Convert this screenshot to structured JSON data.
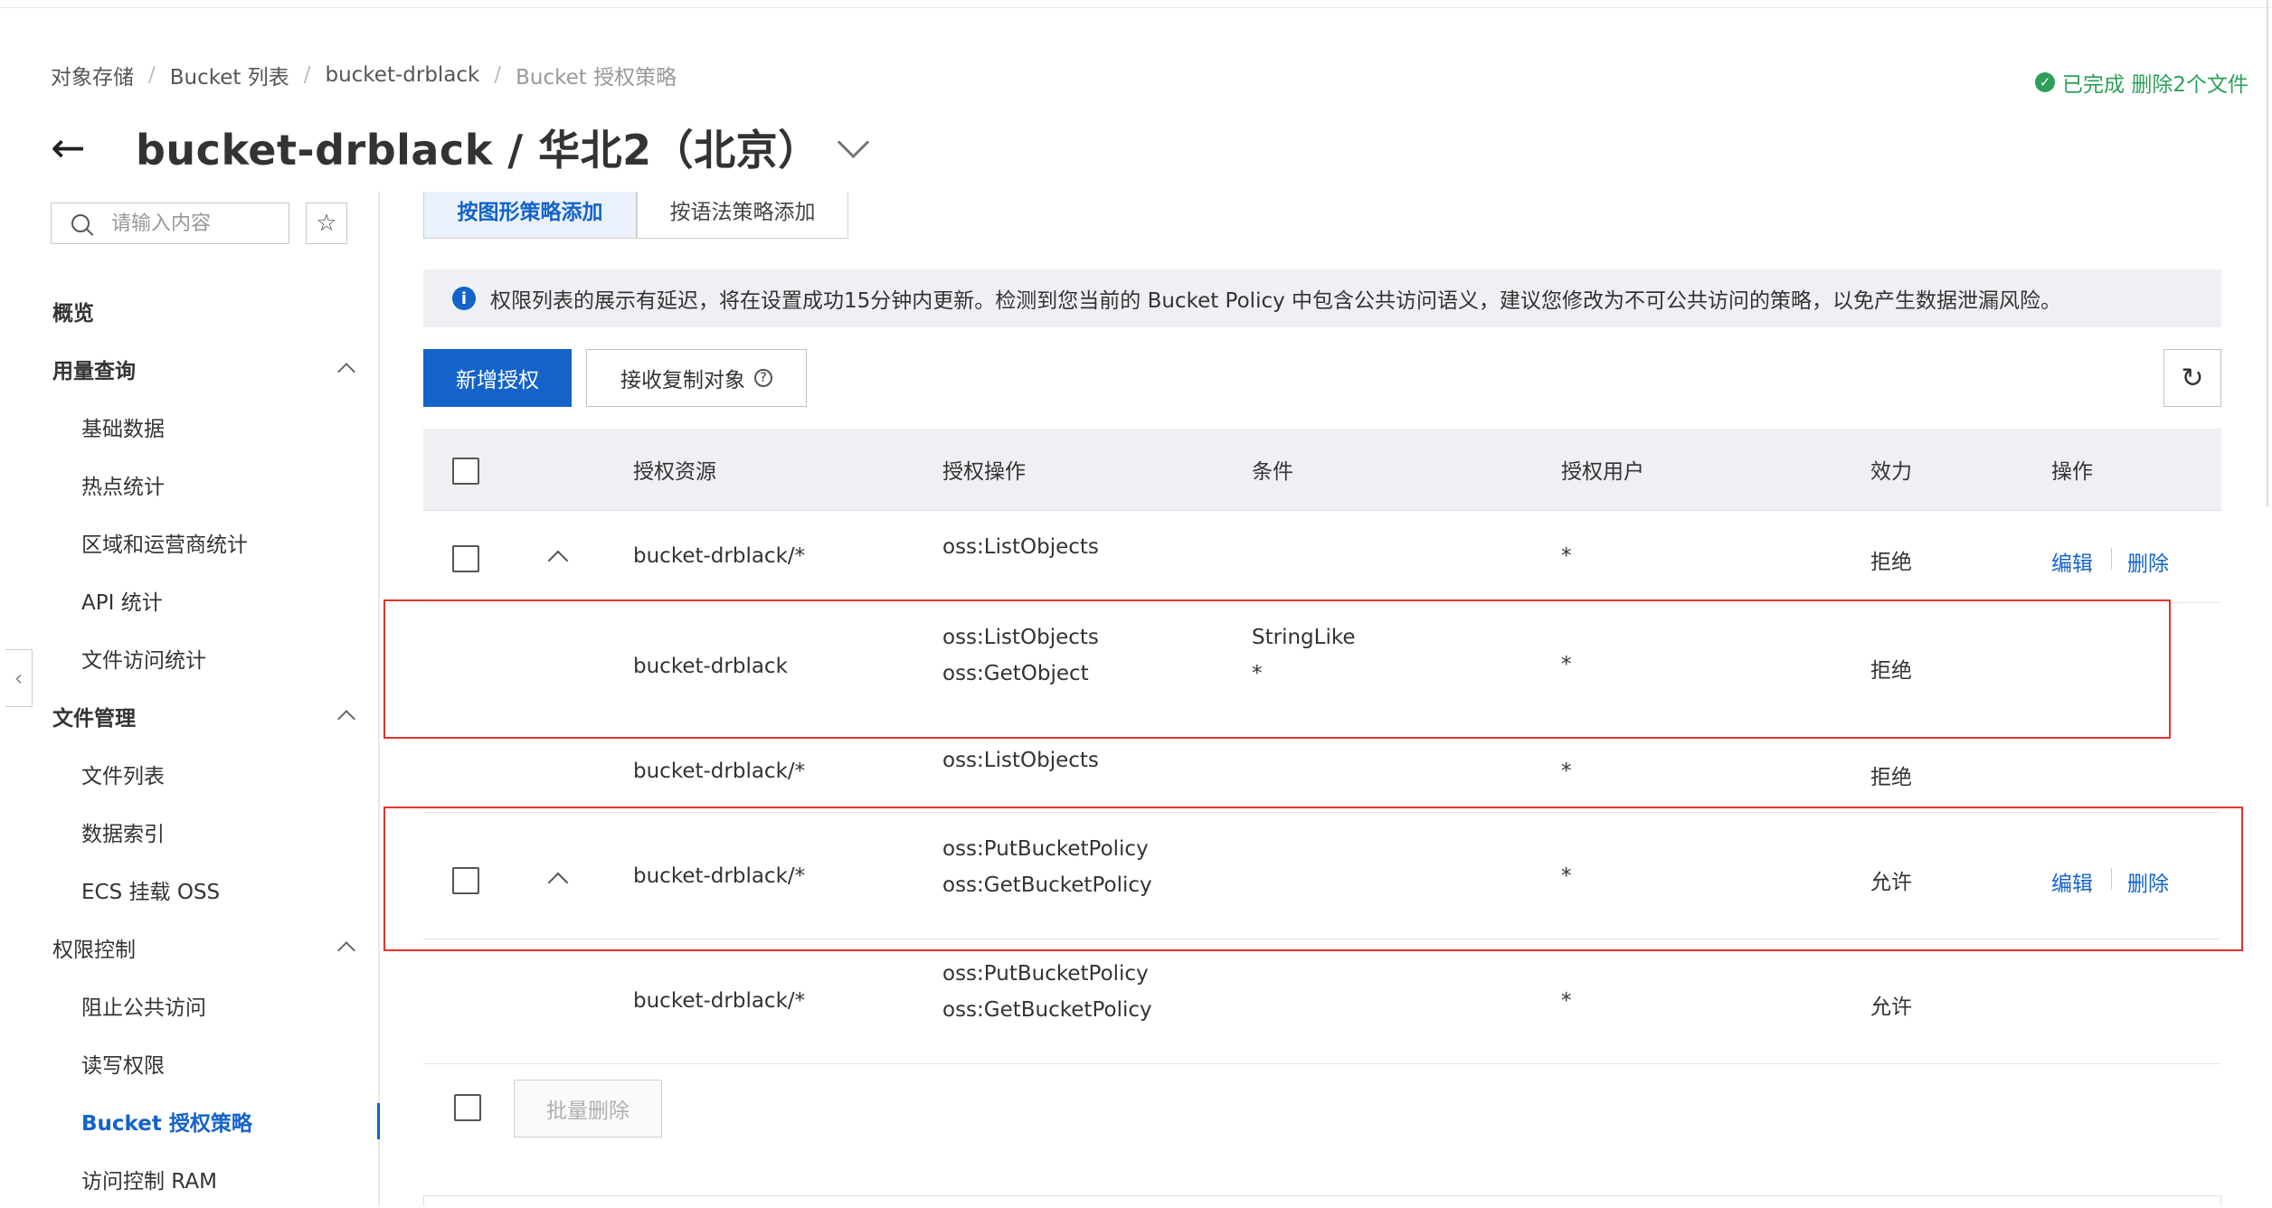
{
  "breadcrumb": [
    "对象存储",
    "Bucket 列表",
    "bucket-drblack",
    "Bucket 授权策略"
  ],
  "status": {
    "text": "已完成 删除2个文件",
    "color": "#2ca05a"
  },
  "header": {
    "back_icon": "arrow-left-icon",
    "title": "bucket-drblack / 华北2（北京）"
  },
  "sidebar": {
    "search_placeholder": "请输入内容",
    "items": [
      {
        "label": "概览",
        "type": "group",
        "expandable": false
      },
      {
        "label": "用量查询",
        "type": "group",
        "expandable": true
      },
      {
        "label": "基础数据",
        "type": "sub"
      },
      {
        "label": "热点统计",
        "type": "sub"
      },
      {
        "label": "区域和运营商统计",
        "type": "sub"
      },
      {
        "label": "API 统计",
        "type": "sub"
      },
      {
        "label": "文件访问统计",
        "type": "sub"
      },
      {
        "label": "文件管理",
        "type": "group",
        "expandable": true
      },
      {
        "label": "文件列表",
        "type": "sub"
      },
      {
        "label": "数据索引",
        "type": "sub"
      },
      {
        "label": "ECS 挂载 OSS",
        "type": "sub"
      },
      {
        "label": "权限控制",
        "type": "group-plain",
        "expandable": true
      },
      {
        "label": "阻止公共访问",
        "type": "sub"
      },
      {
        "label": "读写权限",
        "type": "sub"
      },
      {
        "label": "Bucket 授权策略",
        "type": "sub",
        "active": true
      },
      {
        "label": "访问控制 RAM",
        "type": "sub"
      }
    ]
  },
  "tabs": [
    "按图形策略添加",
    "按语法策略添加"
  ],
  "notice": "权限列表的展示有延迟，将在设置成功15分钟内更新。检测到您当前的 Bucket Policy 中包含公共访问语义，建议您修改为不可公共访问的策略，以免产生数据泄漏风险。",
  "toolbar": {
    "add_label": "新增授权",
    "receive_label": "接收复制对象",
    "help_icon": "question-circle-icon",
    "refresh_icon": "refresh-icon"
  },
  "table": {
    "headers": [
      "授权资源",
      "授权操作",
      "条件",
      "授权用户",
      "效力",
      "操作"
    ],
    "rows": [
      {
        "resource": "bucket-drblack/*",
        "actions": [
          "oss:ListObjects"
        ],
        "conditions": [],
        "user": "*",
        "effect": "拒绝",
        "edit": "编辑",
        "delete": "删除"
      },
      {
        "resource": "bucket-drblack",
        "actions": [
          "oss:ListObjects",
          "oss:GetObject"
        ],
        "conditions": [
          "StringLike",
          "*"
        ],
        "user": "*",
        "effect": "拒绝"
      },
      {
        "resource": "bucket-drblack/*",
        "actions": [
          "oss:ListObjects"
        ],
        "conditions": [],
        "user": "*",
        "effect": "拒绝"
      },
      {
        "resource": "bucket-drblack/*",
        "actions": [
          "oss:PutBucketPolicy",
          "oss:GetBucketPolicy"
        ],
        "conditions": [],
        "user": "*",
        "effect": "允许",
        "edit": "编辑",
        "delete": "删除"
      },
      {
        "resource": "bucket-drblack/*",
        "actions": [
          "oss:PutBucketPolicy",
          "oss:GetBucketPolicy"
        ],
        "conditions": [],
        "user": "*",
        "effect": "允许"
      }
    ]
  },
  "footer": {
    "batch_delete_label": "批量删除"
  },
  "colors": {
    "accent": "#1463c9",
    "highlight": "#e5322d"
  }
}
